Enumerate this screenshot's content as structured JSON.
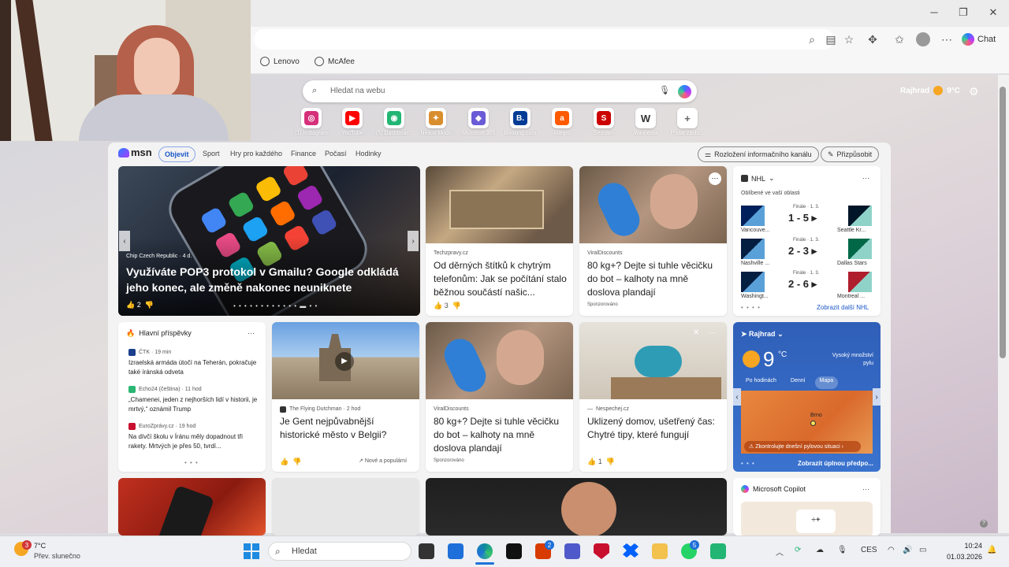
{
  "browser": {
    "tab_chat_label": "Chat",
    "favorites": [
      {
        "label": "Lenovo"
      },
      {
        "label": "McAfee"
      }
    ]
  },
  "newtab": {
    "search_placeholder": "Hledat na webu",
    "location": "Rajhrad",
    "temp": "9°C",
    "quicklinks": [
      {
        "label": "(1) Instagram",
        "icon": "instagram-icon",
        "color": "#d6307b"
      },
      {
        "label": "YouTube",
        "icon": "youtube-icon",
        "color": "#ff0000"
      },
      {
        "label": "(5) Dashboar...",
        "icon": "dashboard-icon",
        "color": "#22b573"
      },
      {
        "label": "Nexus Mods",
        "icon": "nexusmods-icon",
        "color": "#d98e2e"
      },
      {
        "label": "Microsoft 365",
        "icon": "m365-icon",
        "color": "#6a5bd6"
      },
      {
        "label": "Booking.com",
        "icon": "booking-icon",
        "color": "#003b95"
      },
      {
        "label": "Allegro",
        "icon": "allegro-icon",
        "color": "#ff5a00"
      },
      {
        "label": "Seznam",
        "icon": "seznam-icon",
        "color": "#cc0000"
      },
      {
        "label": "Wikipedia",
        "icon": "wikipedia-icon",
        "color": "#333333"
      },
      {
        "label": "Přidat zástu...",
        "icon": "plus-icon",
        "color": "#666666"
      }
    ]
  },
  "msn": {
    "logo": "msn",
    "tabs": [
      "Objevit",
      "Sport",
      "Hry pro každého",
      "Finance",
      "Počasí",
      "Hodinky"
    ],
    "layout_btn": "Rozložení informačního kanálu",
    "customize_btn": "Přizpůsobit",
    "hero": {
      "source": "Chip Czech Republic · 4 d.",
      "title": "Využíváte POP3 protokol v Gmailu? Google odkládá jeho konec, ale změně nakonec neuniknete",
      "likes": "2"
    },
    "card_tech": {
      "source": "Techzpravy.cz",
      "title": "Od děrných štítků k chytrým telefonům: Jak se počítání stalo běžnou součástí našic...",
      "likes": "3"
    },
    "card_viral1": {
      "source": "ViralDiscounts",
      "title": "80 kg+? Dejte si tuhle věcičku do bot – kalhoty na mně doslova plandají",
      "sponsored": "Sponzorováno"
    },
    "nhl": {
      "title": "NHL",
      "subtitle": "Oblíbené ve vaší oblasti",
      "games": [
        {
          "home": "Vancouve...",
          "away": "Seattle Kr...",
          "status": "Finále · 1. 3.",
          "score": "1 - 5",
          "c1": "#00205b",
          "c2": "#001628"
        },
        {
          "home": "Nashville ...",
          "away": "Dallas Stars",
          "status": "Finále · 1. 3.",
          "score": "2 - 3",
          "c1": "#041e42",
          "c2": "#006847"
        },
        {
          "home": "Washingt...",
          "away": "Montreal ...",
          "status": "Finále · 1. 3.",
          "score": "2 - 6",
          "c1": "#041e42",
          "c2": "#af1e2d"
        }
      ],
      "more": "Zobrazit další NHL"
    },
    "main_posts": {
      "title": "Hlavní příspěvky",
      "items": [
        {
          "source": "ČTK · 19 min",
          "text": "Izraelská armáda útočí na Teherán, pokračuje také íránská odveta",
          "color": "#1a3f8c"
        },
        {
          "source": "Echo24 (čeština) · 11 hod",
          "text": "„Chamenei, jeden z nejhorších lidí v historii, je mrtvý,“ oznámil Trump",
          "color": "#2bb673"
        },
        {
          "source": "EuroZprávy.cz · 19 hod",
          "text": "Na dívčí školu v Íránu měly dopadnout tři rakety. Mrtvých je přes 50, tvrdí...",
          "color": "#c8102e"
        }
      ]
    },
    "card_gent": {
      "source": "The Flying Dutchman · 2 hod",
      "title": "Je Gent nejpůvabnější historické město v Belgii?",
      "trend": "Nové a populární"
    },
    "card_viral2": {
      "source": "ViralDiscounts",
      "title": "80 kg+? Dejte si tuhle věcičku do bot – kalhoty na mně doslova plandají",
      "sponsored": "Sponzorováno"
    },
    "card_home": {
      "source": "Nespechej.cz",
      "title": "Uklizený domov, ušetřený čas: Chytré tipy, které fungují",
      "likes": "1"
    },
    "weather": {
      "location": "Rajhrad",
      "temp": "9",
      "unit": "°C",
      "pollen": "Vysoký množství pylu",
      "tabs": [
        "Po hodinách",
        "Denní",
        "Mapa"
      ],
      "city": "Brno",
      "alert": "Zkontrolujte dnešní pylovou situaci",
      "more": "Zobrazit úplnou předpo..."
    },
    "copilot": {
      "title": "Microsoft Copilot"
    }
  },
  "taskbar": {
    "weather_temp": "7°C",
    "weather_desc": "Přev. slunečno",
    "weather_badge": "3",
    "search": "Hledat",
    "lang": "CES",
    "time": "10:24",
    "date": "01.03.2026",
    "badges": {
      "office": "2",
      "whatsapp": "5"
    }
  }
}
